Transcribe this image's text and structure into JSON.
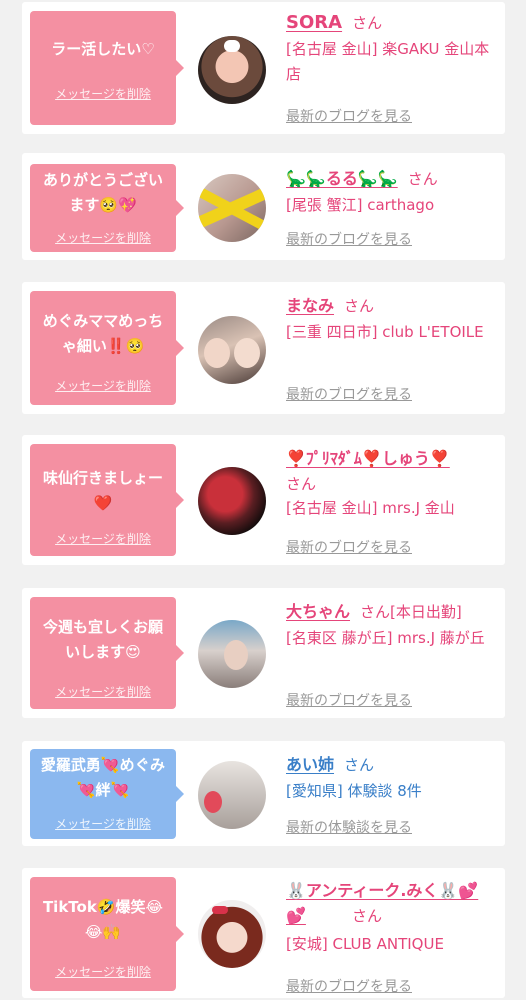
{
  "cards": [
    {
      "message": "ラー活したい♡",
      "delete_label": "メッセージを削除",
      "name": "SORA",
      "honorific": "さん",
      "shop": "[名古屋 金山] 楽GAKU 金山本店",
      "link": "最新のブログを見る",
      "bubble_color": "#f490a2"
    },
    {
      "message": "ありがとうございます🥺💖",
      "delete_label": "メッセージを削除",
      "name": "🦕🦕るる🦕🦕",
      "honorific": "さん",
      "shop": "[尾張 蟹江] carthago",
      "link": "最新のブログを見る",
      "bubble_color": "#f490a2"
    },
    {
      "message": "めぐみママめっちゃ細い‼️🥺",
      "delete_label": "メッセージを削除",
      "name": "まなみ",
      "honorific": "さん",
      "shop": "[三重 四日市] club L'ETOILE",
      "link": "最新のブログを見る",
      "bubble_color": "#f490a2"
    },
    {
      "message": "味仙行きましょー❤️",
      "delete_label": "メッセージを削除",
      "name": "❣️ﾌﾟﾘﾏﾀﾞﾑ❣️しゅう❣️",
      "honorific": "さん",
      "shop": "[名古屋 金山] mrs.J 金山",
      "link": "最新のブログを見る",
      "bubble_color": "#f490a2"
    },
    {
      "message": "今週も宜しくお願いします😍",
      "delete_label": "メッセージを削除",
      "name": "大ちゃん",
      "honorific": "さん[本日出勤]",
      "shop": "[名東区 藤が丘] mrs.J 藤が丘",
      "link": "最新のブログを見る",
      "bubble_color": "#f490a2"
    },
    {
      "message": "愛羅武勇💘めぐみ💘絆💘",
      "delete_label": "メッセージを削除",
      "name": "あい姉",
      "honorific": "さん",
      "shop": "[愛知県] 体験談 8件",
      "link": "最新の体験談を見る",
      "bubble_color": "#8bb8ef"
    },
    {
      "message": "TikTok🤣爆笑😂😂🙌",
      "delete_label": "メッセージを削除",
      "name": "🐰アンティーク.みく🐰💕💕",
      "honorific": "さん",
      "shop": "[安城] CLUB ANTIQUE",
      "link": "最新のブログを見る",
      "bubble_color": "#f490a2"
    }
  ]
}
